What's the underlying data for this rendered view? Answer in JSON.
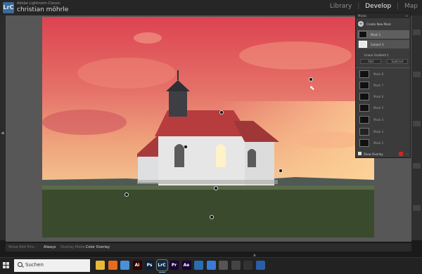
{
  "app": {
    "brand": "Adobe Lightroom Classic",
    "user": "christian möhrle",
    "logo": "LrC",
    "modules": [
      "Library",
      "Develop",
      "Map"
    ],
    "active_module": "Develop"
  },
  "masks_panel": {
    "title": "Masks",
    "close": "×",
    "create_label": "Create New Mask",
    "mask1_label": "Mask 1",
    "subject_label": "Subject 1",
    "component_label": "Linear Gradient 1",
    "add_label": "Add",
    "subtract_label": "Subtract",
    "other_masks": [
      "Mask 8",
      "Mask 7",
      "Mask 6",
      "Mask 5",
      "Mask 4",
      "Mask 3",
      "Mask 2"
    ],
    "show_overlay_label": "Show Overlay",
    "show_overlay_checked": true,
    "overlay_color": "#d8231f",
    "more": "..."
  },
  "toolbar": {
    "show_edit_pins": "Show Edit Pins :",
    "always": "Always",
    "overlay_mode": "Overlay Mode :",
    "color_overlay": "Color Overlay"
  },
  "taskbar": {
    "search_placeholder": "Suchen",
    "apps": [
      {
        "icon": "file-explorer-icon",
        "label": "",
        "color": "#e7b93a"
      },
      {
        "icon": "firefox-icon",
        "label": "",
        "color": "#e66a1f"
      },
      {
        "icon": "chrome-icon",
        "label": "",
        "color": "#4a90d9"
      },
      {
        "icon": "illustrator-icon",
        "label": "Ai",
        "color": "#310000"
      },
      {
        "icon": "photoshop-icon",
        "label": "Ps",
        "color": "#0a1f3a"
      },
      {
        "icon": "lightroom-classic-icon",
        "label": "LrC",
        "color": "#0e2b4a"
      },
      {
        "icon": "premiere-icon",
        "label": "Pr",
        "color": "#1b0033"
      },
      {
        "icon": "after-effects-icon",
        "label": "Ae",
        "color": "#1a0033"
      },
      {
        "icon": "globe-icon",
        "label": "",
        "color": "#2b6cb0"
      },
      {
        "icon": "photos-icon",
        "label": "",
        "color": "#3a7bd5"
      },
      {
        "icon": "settings-icon",
        "label": "",
        "color": "#555555"
      },
      {
        "icon": "camera-app-icon",
        "label": "",
        "color": "#444444"
      },
      {
        "icon": "wifi-app-icon",
        "label": "",
        "color": "#333333"
      },
      {
        "icon": "monitor-app-icon",
        "label": "",
        "color": "#2b5ea8"
      }
    ]
  }
}
